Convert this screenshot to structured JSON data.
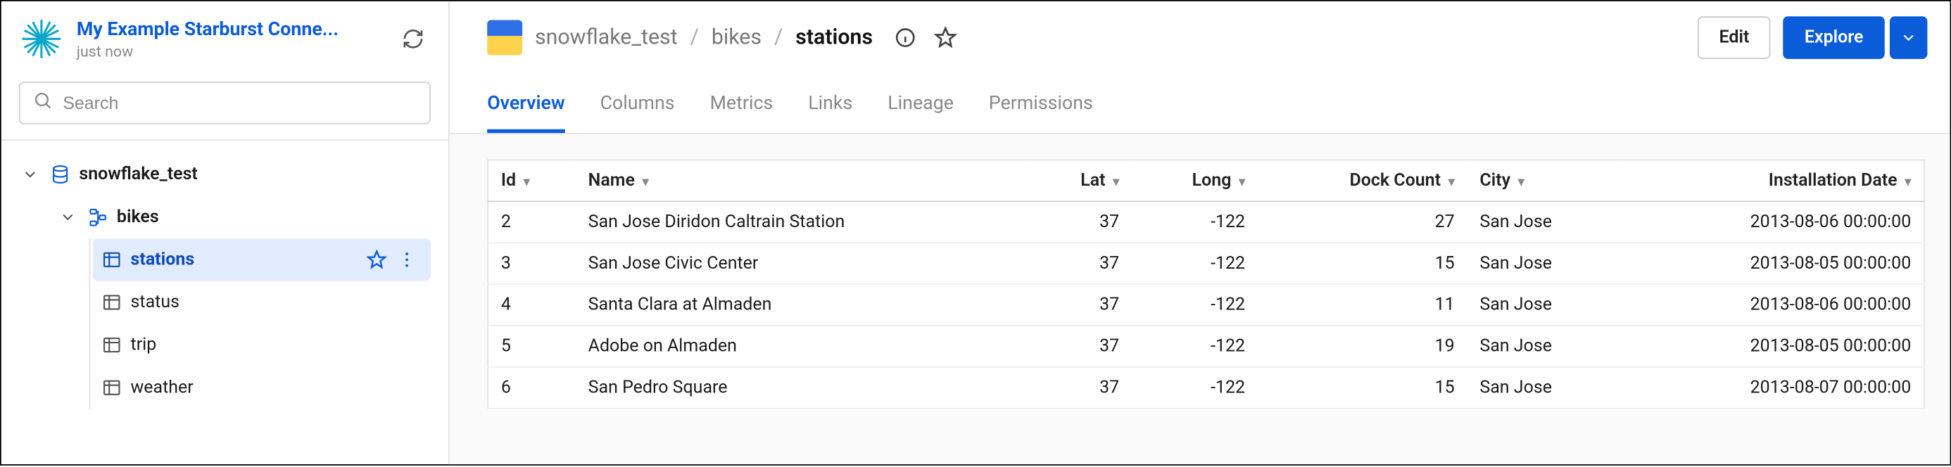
{
  "sidebar": {
    "connection_name": "My Example Starburst Conne...",
    "connection_sub": "just now",
    "search_placeholder": "Search",
    "tree": {
      "db": "snowflake_test",
      "schema": "bikes",
      "tables": [
        {
          "name": "stations",
          "selected": true
        },
        {
          "name": "status",
          "selected": false
        },
        {
          "name": "trip",
          "selected": false
        },
        {
          "name": "weather",
          "selected": false
        }
      ]
    }
  },
  "header": {
    "crumbs": [
      "snowflake_test",
      "bikes",
      "stations"
    ],
    "edit_label": "Edit",
    "explore_label": "Explore"
  },
  "tabs": [
    {
      "label": "Overview",
      "active": true
    },
    {
      "label": "Columns",
      "active": false
    },
    {
      "label": "Metrics",
      "active": false
    },
    {
      "label": "Links",
      "active": false
    },
    {
      "label": "Lineage",
      "active": false
    },
    {
      "label": "Permissions",
      "active": false
    }
  ],
  "table": {
    "columns": [
      {
        "key": "id",
        "label": "Id",
        "type": "num-left"
      },
      {
        "key": "name",
        "label": "Name",
        "type": "text"
      },
      {
        "key": "lat",
        "label": "Lat",
        "type": "num"
      },
      {
        "key": "long",
        "label": "Long",
        "type": "num"
      },
      {
        "key": "dock_count",
        "label": "Dock Count",
        "type": "num"
      },
      {
        "key": "city",
        "label": "City",
        "type": "text"
      },
      {
        "key": "install",
        "label": "Installation Date",
        "type": "dt"
      }
    ],
    "rows": [
      {
        "id": 2,
        "name": "San Jose Diridon Caltrain Station",
        "lat": 37,
        "long": -122,
        "dock_count": 27,
        "city": "San Jose",
        "install": "2013-08-06 00:00:00"
      },
      {
        "id": 3,
        "name": "San Jose Civic Center",
        "lat": 37,
        "long": -122,
        "dock_count": 15,
        "city": "San Jose",
        "install": "2013-08-05 00:00:00"
      },
      {
        "id": 4,
        "name": "Santa Clara at Almaden",
        "lat": 37,
        "long": -122,
        "dock_count": 11,
        "city": "San Jose",
        "install": "2013-08-06 00:00:00"
      },
      {
        "id": 5,
        "name": "Adobe on Almaden",
        "lat": 37,
        "long": -122,
        "dock_count": 19,
        "city": "San Jose",
        "install": "2013-08-05 00:00:00"
      },
      {
        "id": 6,
        "name": "San Pedro Square",
        "lat": 37,
        "long": -122,
        "dock_count": 15,
        "city": "San Jose",
        "install": "2013-08-07 00:00:00"
      }
    ]
  }
}
